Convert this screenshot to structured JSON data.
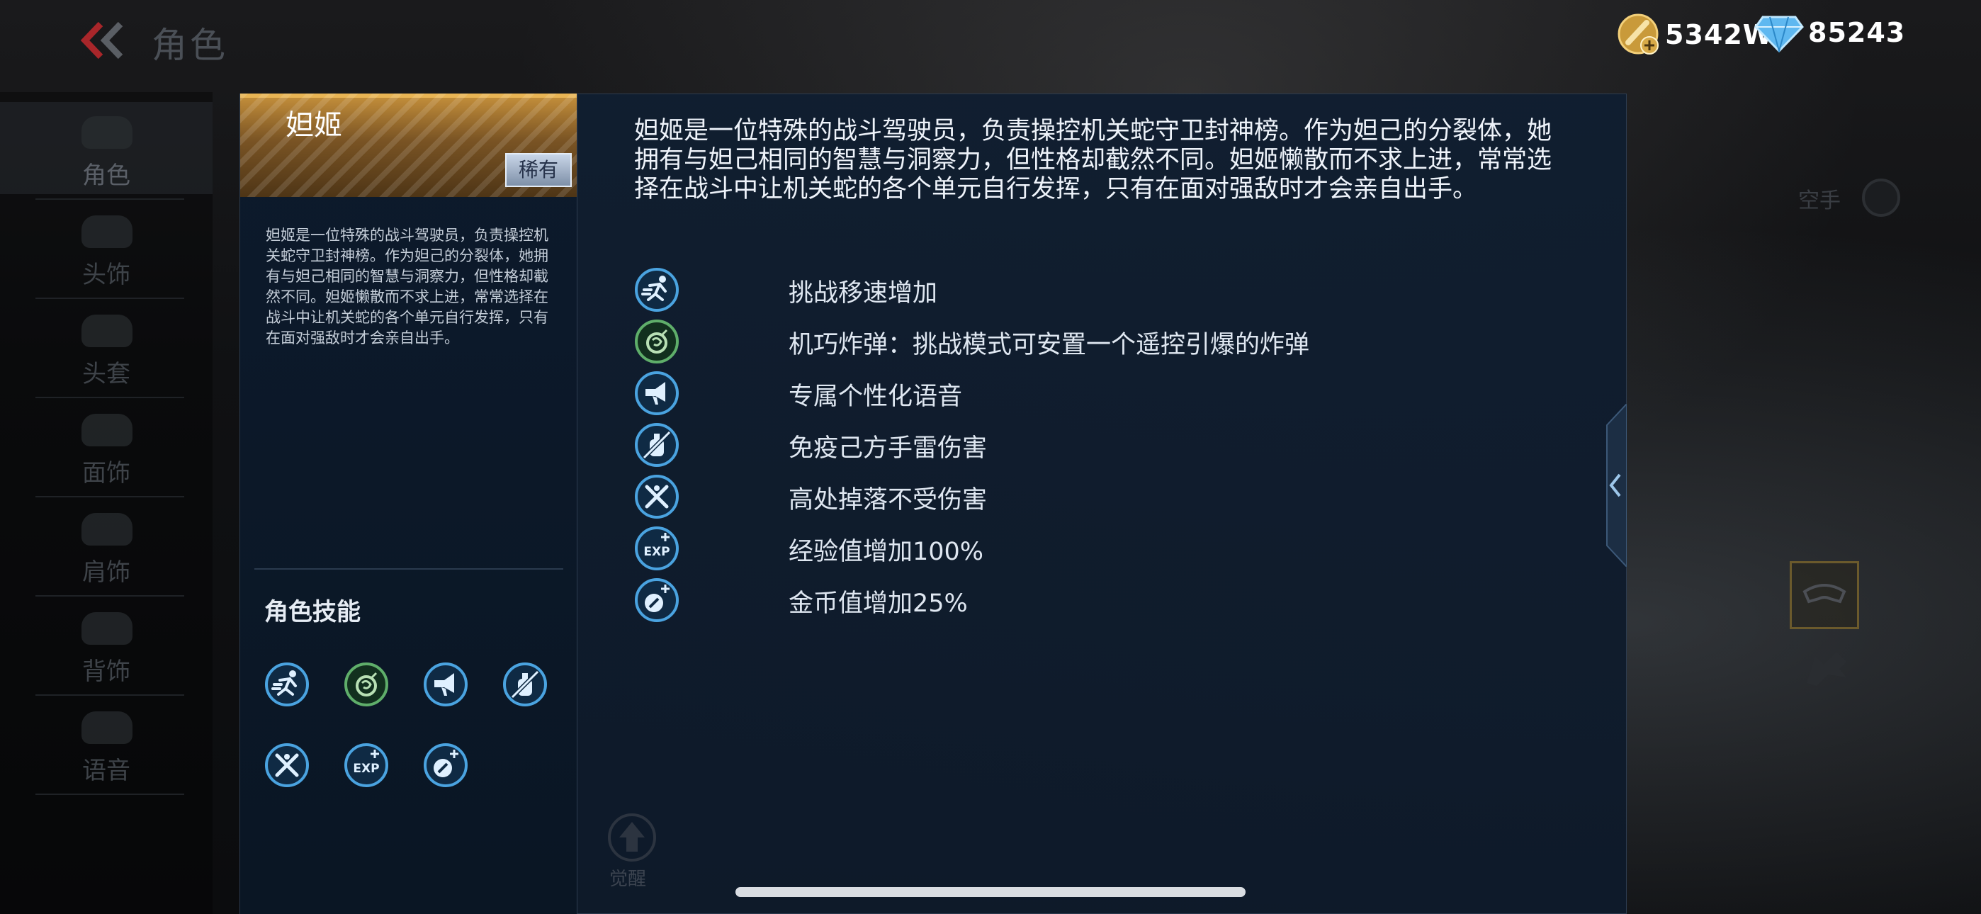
{
  "header": {
    "title": "角色",
    "gold": "5342W",
    "diamonds": "85243"
  },
  "sidebar": {
    "items": [
      {
        "label": "角色",
        "icon": "cat-head-icon"
      },
      {
        "label": "头饰",
        "icon": "headwear-icon"
      },
      {
        "label": "头套",
        "icon": "headgear-icon"
      },
      {
        "label": "面饰",
        "icon": "mask-icon"
      },
      {
        "label": "肩饰",
        "icon": "shoulder-icon"
      },
      {
        "label": "背饰",
        "icon": "back-icon"
      },
      {
        "label": "语音",
        "icon": "voice-icon"
      }
    ]
  },
  "card": {
    "name": "妲姬",
    "rarity": "稀有",
    "description": "妲姬是一位特殊的战斗驾驶员，负责操控机关蛇守卫封神榜。作为妲己的分裂体，她拥有与妲己相同的智慧与洞察力，但性格却截然不同。妲姬懒散而不求上进，常常选择在战斗中让机关蛇的各个单元自行发挥，只有在面对强敌时才会亲自出手。",
    "skills_title": "角色技能"
  },
  "detail": {
    "description": "妲姬是一位特殊的战斗驾驶员，负责操控机关蛇守卫封神榜。作为妲己的分裂体，她拥有与妲己相同的智慧与洞察力，但性格却截然不同。妲姬懒散而不求上进，常常选择在战斗中让机关蛇的各个单元自行发挥，只有在面对强敌时才会亲自出手。",
    "skills": [
      {
        "text": "挑战移速增加",
        "icon": "running-man-icon"
      },
      {
        "text": "机巧炸弹：挑战模式可安置一个遥控引爆的炸弹",
        "icon": "bomb-icon"
      },
      {
        "text": "专属个性化语音",
        "icon": "megaphone-icon"
      },
      {
        "text": "免疫己方手雷伤害",
        "icon": "grenade-immune-icon"
      },
      {
        "text": "高处掉落不受伤害",
        "icon": "fall-protect-icon"
      },
      {
        "text": "经验值增加100%",
        "icon": "exp-plus-icon"
      },
      {
        "text": "金币值增加25%",
        "icon": "coin-plus-icon"
      }
    ]
  },
  "overlay": {
    "empty_hand": "空手",
    "awaken": "觉醒"
  },
  "colors": {
    "card_header": "#c8923c",
    "skill_icon_blue": "#4aa3e0",
    "skill_icon_green": "#5fae6a",
    "panel_bg": "#0f1d30"
  }
}
